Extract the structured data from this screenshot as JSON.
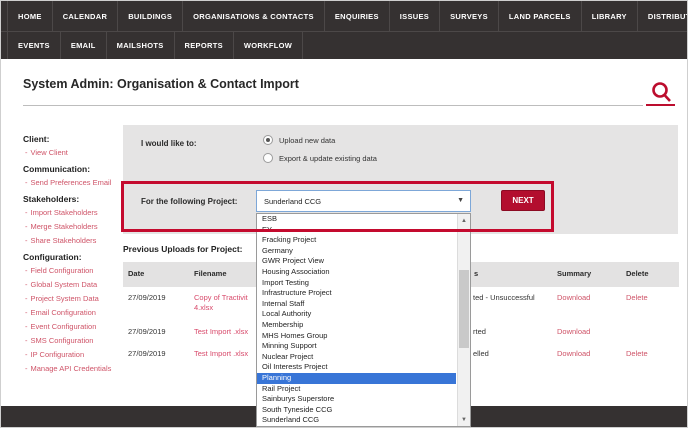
{
  "nav": {
    "row1": [
      "HOME",
      "CALENDAR",
      "BUILDINGS",
      "ORGANISATIONS & CONTACTS",
      "ENQUIRIES",
      "ISSUES",
      "SURVEYS",
      "LAND PARCELS",
      "LIBRARY",
      "DISTRIBUTION LISTS"
    ],
    "row2": [
      "EVENTS",
      "EMAIL",
      "MAILSHOTS",
      "REPORTS",
      "WORKFLOW"
    ]
  },
  "header": {
    "title": "System Admin: Organisation & Contact Import"
  },
  "sidebar": {
    "sections": [
      {
        "heading": "Client:",
        "links": [
          "View Client"
        ]
      },
      {
        "heading": "Communication:",
        "links": [
          "Send Preferences Email"
        ]
      },
      {
        "heading": "Stakeholders:",
        "links": [
          "Import Stakeholders",
          "Merge Stakeholders",
          "Share Stakeholders"
        ]
      },
      {
        "heading": "Configuration:",
        "links": [
          "Field Configuration",
          "Global System Data",
          "Project System Data",
          "Email Configuration",
          "Event Configuration",
          "SMS Configuration",
          "IP Configuration",
          "Manage API Credentials"
        ]
      }
    ]
  },
  "form": {
    "intent_label": "I would like to:",
    "options": [
      {
        "label": "Upload new data",
        "selected": true
      },
      {
        "label": "Export & update existing data",
        "selected": false
      }
    ],
    "project_label": "For the following Project:",
    "project_selected": "Sunderland CCG",
    "next_label": "NEXT",
    "dropdown_options": [
      "ESB",
      "EY",
      "Fracking Project",
      "Germany",
      "GWR Project View",
      "Housing Association",
      "Import Testing",
      "Infrastructure Project",
      "Internal Staff",
      "Local Authority",
      "Membership",
      "MHS Homes Group",
      "Minning Support",
      "Nuclear Project",
      "Oil Interests Project",
      "Planning",
      "Rail Project",
      "Sainburys Superstore",
      "South Tyneside CCG",
      "Sunderland CCG"
    ],
    "highlighted_option": "Planning"
  },
  "table": {
    "heading": "Previous Uploads for Project:",
    "columns": {
      "date": "Date",
      "filename": "Filename",
      "status_fragment": "s",
      "summary": "Summary",
      "delete": "Delete"
    },
    "rows": [
      {
        "date": "27/09/2019",
        "filename_lines": [
          "Copy of Tractivit",
          "4.xlsx"
        ],
        "status_fragment": "ted - Unsuccessful",
        "summary": "Download",
        "delete": "Delete"
      },
      {
        "date": "27/09/2019",
        "filename_lines": [
          "Test Import .xlsx"
        ],
        "status_fragment": "rted",
        "summary": "Download",
        "delete": ""
      },
      {
        "date": "27/09/2019",
        "filename_lines": [
          "Test Import .xlsx"
        ],
        "status_fragment": "elled",
        "summary": "Download",
        "delete": "Delete"
      }
    ],
    "row_tops": [
      292,
      326,
      348
    ]
  },
  "colors": {
    "accent": "#bc0d2e",
    "annotation": "#c40a2e",
    "link": "#cf5468",
    "filename_link": "#d84a6b",
    "nav_bg": "#353131",
    "panel_bg": "#e5e4e4",
    "highlight_blue": "#3875d7",
    "footer_bg": "#353131"
  }
}
